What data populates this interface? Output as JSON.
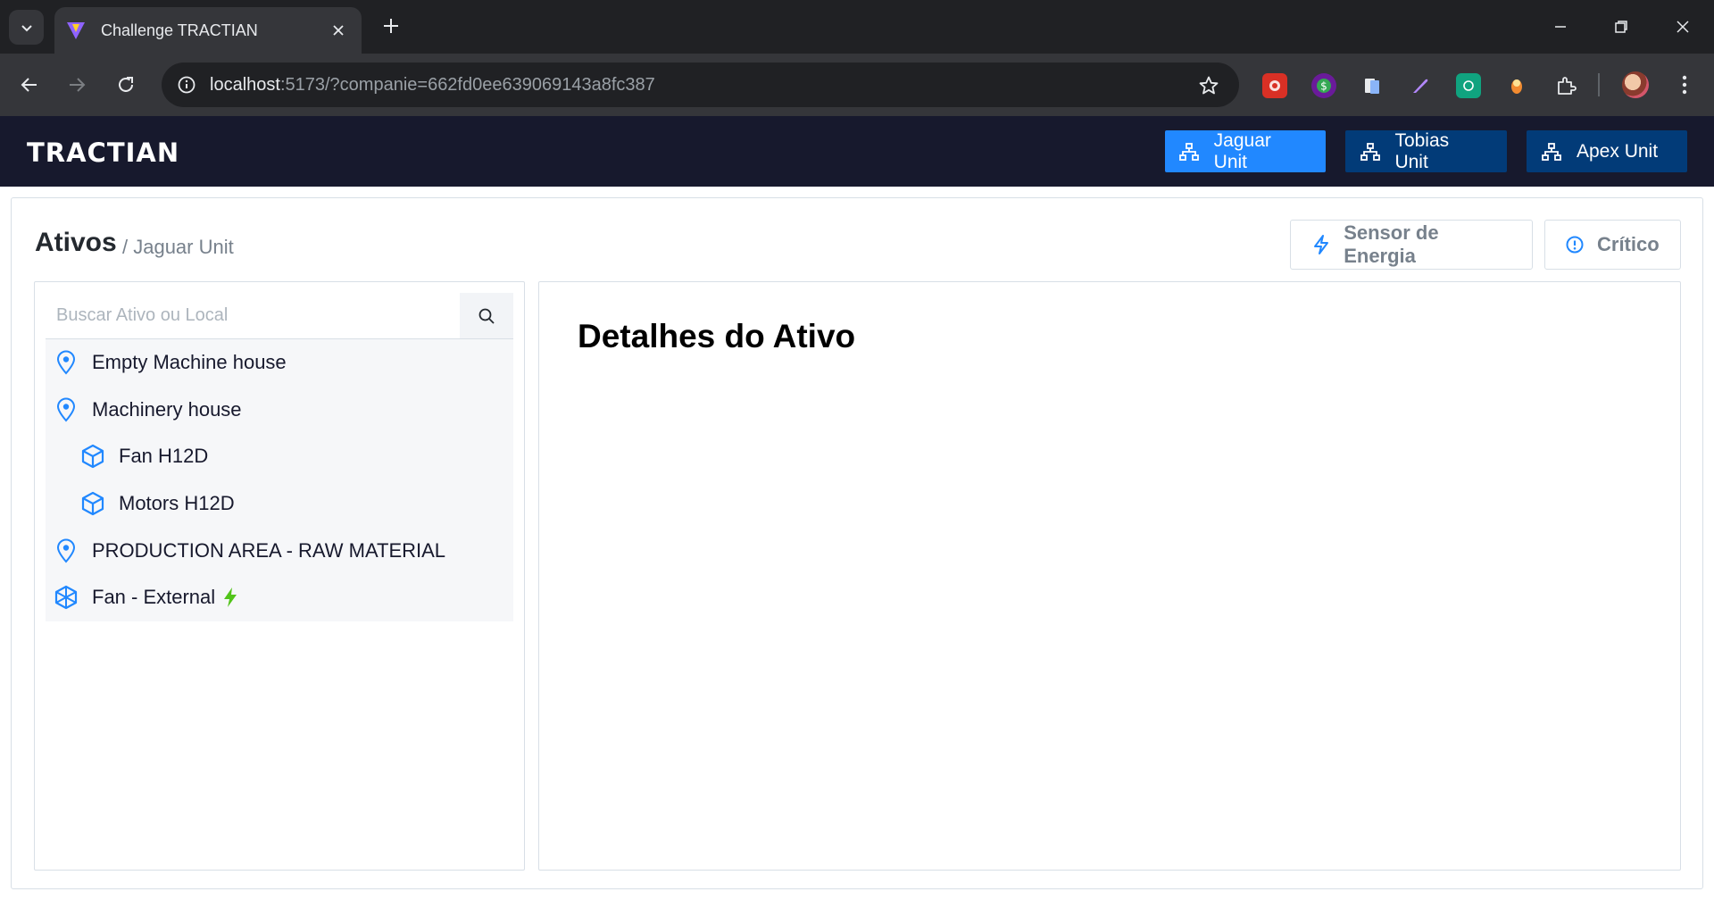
{
  "browser": {
    "tab_title": "Challenge TRACTIAN",
    "url_host": "localhost",
    "url_rest": ":5173/?companie=662fd0ee639069143a8fc387"
  },
  "header": {
    "logo": "TRACTIAN",
    "units": [
      {
        "label": "Jaguar Unit",
        "active": true
      },
      {
        "label": "Tobias Unit",
        "active": false
      },
      {
        "label": "Apex Unit",
        "active": false
      }
    ]
  },
  "page": {
    "title": "Ativos",
    "breadcrumb": "/ Jaguar Unit",
    "filters": {
      "energy": "Sensor de Energia",
      "critical": "Crítico"
    }
  },
  "tree": {
    "search_placeholder": "Buscar Ativo ou Local",
    "items": [
      {
        "label": "Empty Machine house",
        "icon": "location-icon",
        "level": 0
      },
      {
        "label": "Machinery house",
        "icon": "location-icon",
        "level": 0
      },
      {
        "label": "Fan H12D",
        "icon": "asset-cube-icon",
        "level": 1
      },
      {
        "label": "Motors H12D",
        "icon": "asset-cube-icon",
        "level": 1
      },
      {
        "label": "PRODUCTION AREA - RAW MATERIAL",
        "icon": "location-icon",
        "level": 0
      },
      {
        "label": "Fan - External",
        "icon": "component-icon",
        "level": 0,
        "status": "energy-bolt-icon"
      }
    ]
  },
  "details": {
    "title": "Detalhes do Ativo"
  },
  "colors": {
    "header_bg": "#17192d",
    "unit_active": "#2188ff",
    "unit_inactive": "#023b78",
    "icon_blue": "#2188ff",
    "bolt_green": "#52c41a"
  }
}
